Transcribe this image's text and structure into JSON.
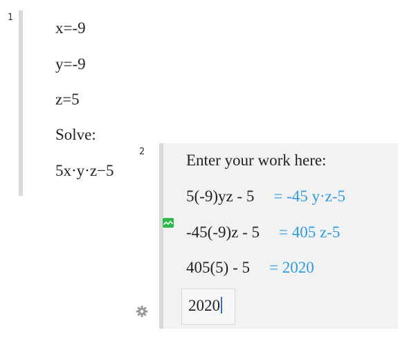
{
  "cells": [
    {
      "number": "1",
      "lines": [
        "x=-9",
        "y=-9",
        "z=5",
        "Solve:",
        "5x·y·z−5"
      ]
    },
    {
      "number": "2",
      "prompt": "Enter your work here:",
      "steps": [
        {
          "input": "5(-9)yz - 5",
          "result": "= -45 y·z-5"
        },
        {
          "input": "-45(-9)z - 5",
          "result": "= 405 z-5"
        },
        {
          "input": "405(5) - 5",
          "result": "= 2020"
        }
      ],
      "current_input": "2020"
    }
  ],
  "icons": {
    "graph": "graph-icon",
    "settings": "gear-icon"
  },
  "colors": {
    "result": "#2f9be0",
    "graph_icon": "#2eb84c",
    "cell_bar": "#d9d9d9",
    "work_panel": "#f2f2f2",
    "caret": "#2f6fd6"
  }
}
